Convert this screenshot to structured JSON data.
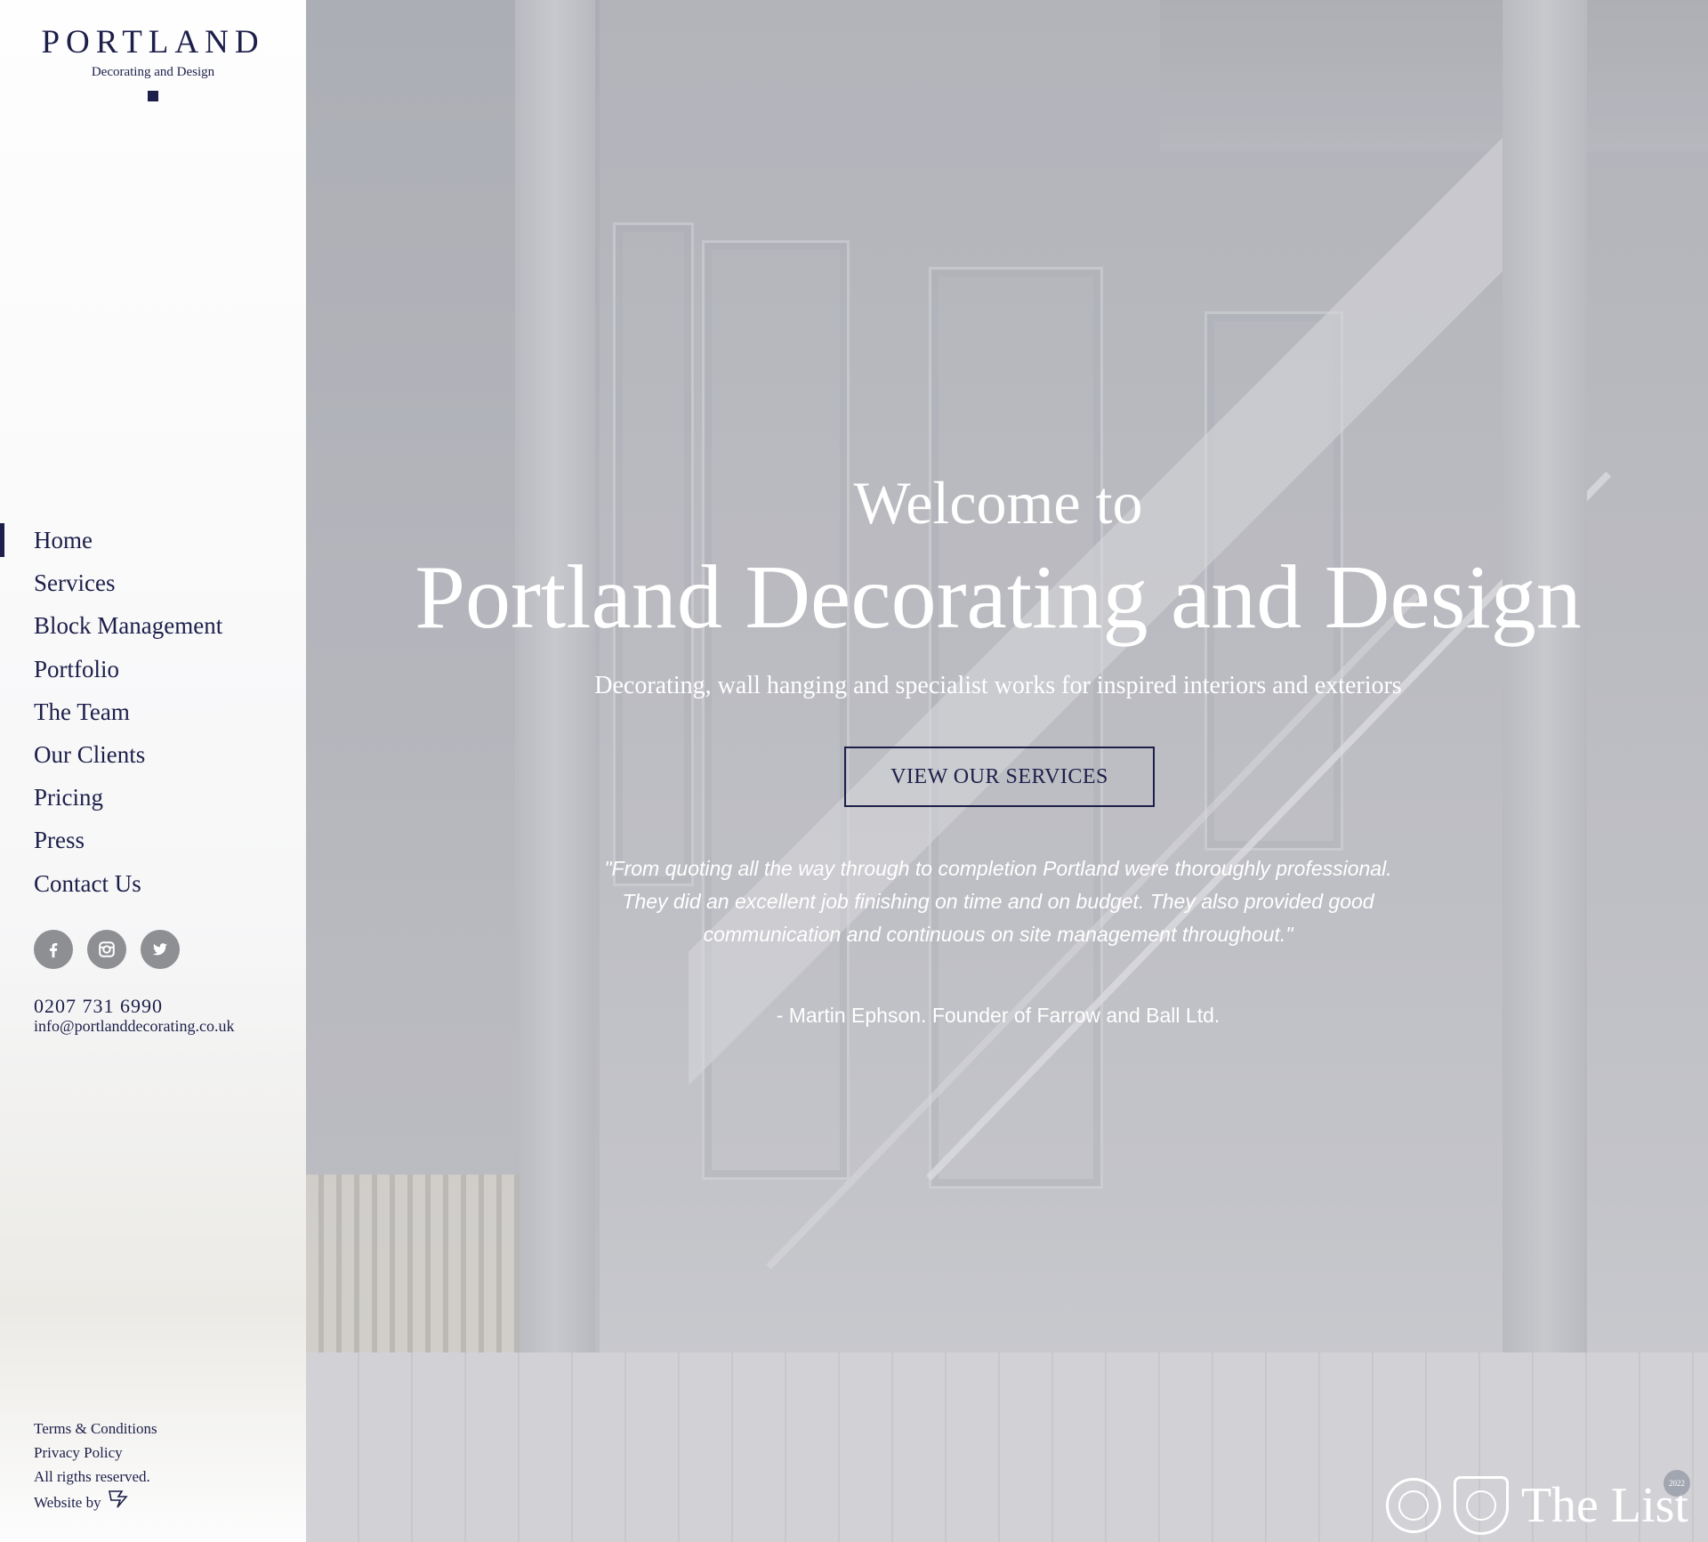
{
  "brand": {
    "name": "PORTLAND",
    "tagline": "Decorating and Design"
  },
  "nav": [
    {
      "label": "Home",
      "active": true
    },
    {
      "label": "Services",
      "active": false
    },
    {
      "label": "Block Management",
      "active": false
    },
    {
      "label": "Portfolio",
      "active": false
    },
    {
      "label": "The Team",
      "active": false
    },
    {
      "label": "Our Clients",
      "active": false
    },
    {
      "label": "Pricing",
      "active": false
    },
    {
      "label": "Press",
      "active": false
    },
    {
      "label": "Contact Us",
      "active": false
    }
  ],
  "social": [
    "facebook-icon",
    "instagram-icon",
    "twitter-icon"
  ],
  "contact": {
    "phone": "0207 731 6990",
    "email": "info@portlanddecorating.co.uk"
  },
  "footer": {
    "terms": "Terms & Conditions",
    "privacy": "Privacy Policy",
    "rights": "All rigths reserved.",
    "website_by": "Website by"
  },
  "hero": {
    "welcome": "Welcome to",
    "title": "Portland Decorating and Design",
    "tagline": "Decorating, wall hanging and specialist works for inspired interiors and exteriors",
    "cta": "VIEW OUR SERVICES",
    "quote": "\"From quoting all the way through to completion Portland were thoroughly professional. They did an excellent job finishing on time and on budget. They also provided good communication and continuous on site management throughout.\"",
    "attribution": "- Martin Ephson. Founder of Farrow and Ball Ltd."
  },
  "badges": {
    "list_logo": "The List",
    "list_year": "2022"
  },
  "colors": {
    "navy": "#1d1f4a",
    "icon_grey": "#8e8f93"
  }
}
